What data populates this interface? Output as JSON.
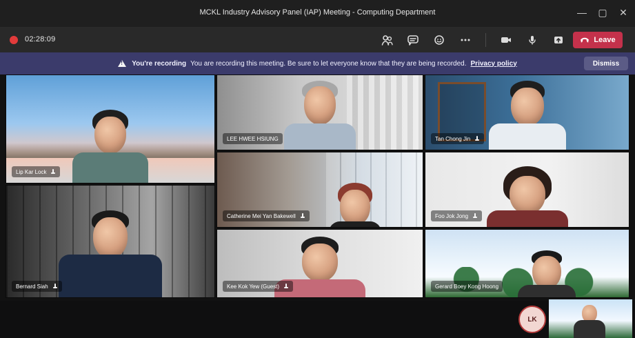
{
  "window": {
    "title": "MCKL Industry Advisory Panel (IAP) Meeting - Computing Department",
    "controls": {
      "minimize_icon": "minimize-icon",
      "maximize_icon": "maximize-icon",
      "close_icon": "close-icon"
    }
  },
  "toolbar": {
    "timer": "02:28:09",
    "leave_label": "Leave",
    "icons": [
      {
        "name": "participants-icon",
        "glyph": "👥"
      },
      {
        "name": "chat-icon",
        "glyph": "💬"
      },
      {
        "name": "reactions-icon",
        "glyph": "☺"
      },
      {
        "name": "more-icon",
        "glyph": "⋯"
      },
      {
        "name": "camera-icon",
        "glyph": "■"
      },
      {
        "name": "mic-icon",
        "glyph": "🎤"
      },
      {
        "name": "share-icon",
        "glyph": "⬆"
      }
    ]
  },
  "banner": {
    "strong": "You're recording",
    "text": "You are recording this meeting. Be sure to let everyone know that they are being recorded.",
    "link": "Privacy policy",
    "dismiss": "Dismiss"
  },
  "participants": [
    {
      "name": "Lip Kar Lock",
      "tile": "lip"
    },
    {
      "name": "LEE HWEE HSIUNG",
      "tile": "lee"
    },
    {
      "name": "Tan Chong Jin",
      "tile": "tan"
    },
    {
      "name": "Catherine Mei Yan Bakewell",
      "tile": "cath"
    },
    {
      "name": "Foo Jok Jong",
      "tile": "foo"
    },
    {
      "name": "Bernard Siah",
      "tile": "bern"
    },
    {
      "name": "Kee Kok Yew (Guest)",
      "tile": "kee"
    },
    {
      "name": "Gerard Boey Kong Hoong",
      "tile": "ger"
    }
  ],
  "self": {
    "initials": "LK"
  },
  "colors": {
    "titlebar": "#1f1f1f",
    "toolbar": "#292929",
    "banner": "#3b3b6b",
    "leave": "#c4314b",
    "recording": "#e23b3b"
  }
}
